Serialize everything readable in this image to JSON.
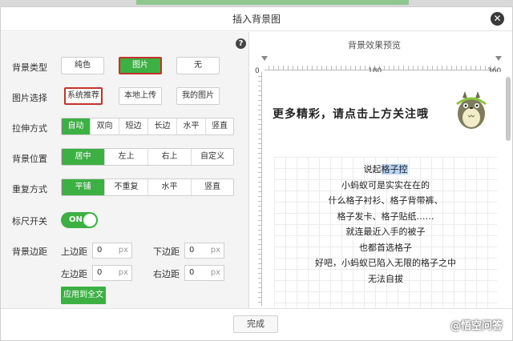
{
  "dialog": {
    "title": "插入背景图",
    "close_glyph": "✕"
  },
  "help_glyph": "?",
  "rows": {
    "bg_type": {
      "label": "背景类型",
      "options": [
        "纯色",
        "图片",
        "无"
      ]
    },
    "img_select": {
      "label": "图片选择",
      "options": [
        "系统推荐",
        "本地上传",
        "我的图片"
      ]
    },
    "stretch": {
      "label": "拉伸方式",
      "options": [
        "自动",
        "双向",
        "短边",
        "长边",
        "水平",
        "竖直"
      ]
    },
    "position": {
      "label": "背景位置",
      "options": [
        "居中",
        "左上",
        "右上",
        "自定义"
      ]
    },
    "repeat": {
      "label": "重复方式",
      "options": [
        "平铺",
        "不重复",
        "水平",
        "竖直"
      ]
    },
    "ruler": {
      "label": "标尺开关",
      "toggle_text": "ON"
    },
    "margin": {
      "label": "背景边距",
      "top_label": "上边距",
      "bottom_label": "下边距",
      "left_label": "左边距",
      "right_label": "右边距",
      "top_value": "0",
      "bottom_value": "0",
      "left_value": "0",
      "right_value": "0",
      "unit": "px"
    }
  },
  "apply_button": "应用到全文",
  "preview": {
    "title": "背景效果预览",
    "ruler_labels": [
      "0",
      "180",
      "360"
    ],
    "headline": "更多精彩，请点击上方关注哦",
    "poem_first_prefix": "说起",
    "poem_first_highlight": "格子控",
    "poem_lines": [
      "小蚂蚁可是实实在在的",
      "什么格子衬衫、格子背带裤、",
      "格子发卡、格子贴纸……",
      "就连最近入手的被子",
      "也都首选格子",
      "好吧，小蚂蚁已陷入无限的格子之中",
      "无法自拔"
    ]
  },
  "footer": {
    "done_label": "完成",
    "watermark": "@悟空问答"
  },
  "colors": {
    "accent_green": "#3cb043",
    "selection_red": "#c7312b",
    "highlight": "#b8d4f5"
  }
}
